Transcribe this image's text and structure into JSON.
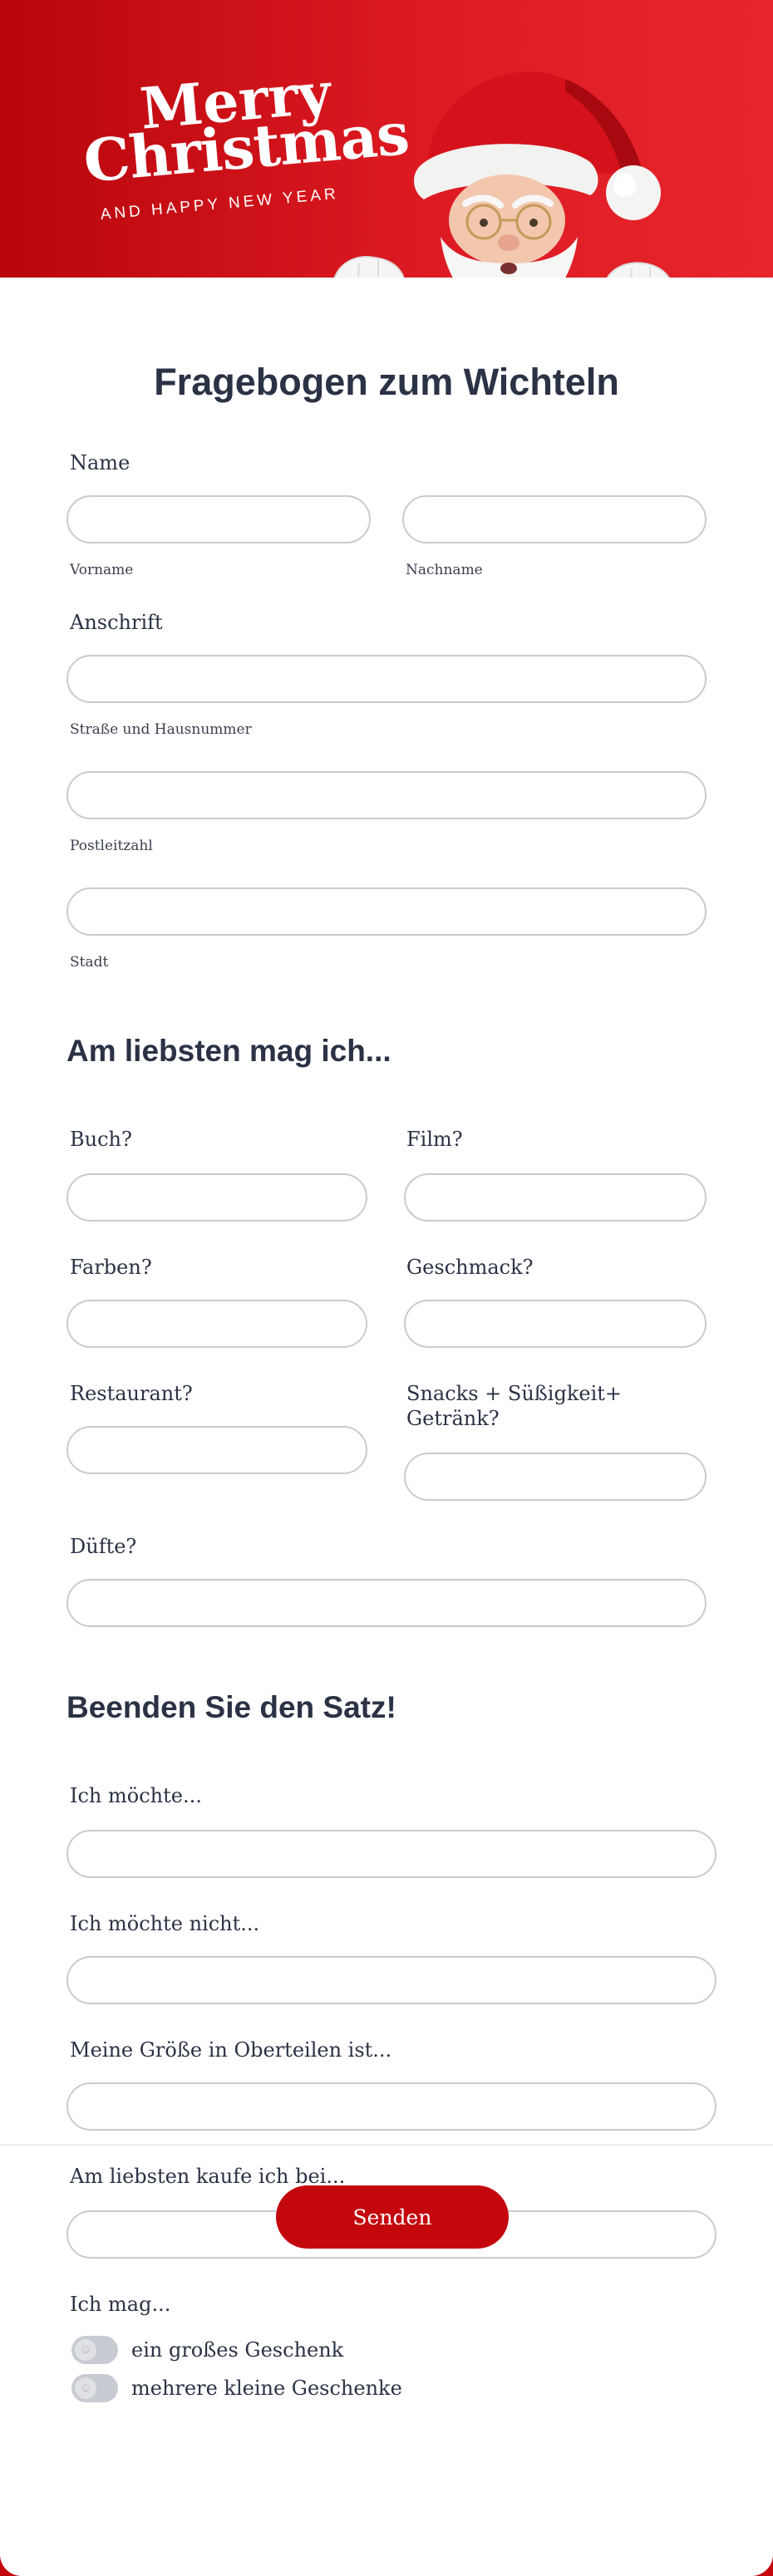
{
  "header": {
    "logo_line1": "Merry",
    "logo_line2": "Christmas",
    "logo_line3": "AND HAPPY NEW YEAR",
    "colors": {
      "background": "#d6141c",
      "text": "#ffffff"
    }
  },
  "form": {
    "title": "Fragebogen zum Wichteln",
    "name": {
      "label": "Name",
      "first_sublabel": "Vorname",
      "last_sublabel": "Nachname",
      "first_value": "",
      "last_value": ""
    },
    "address": {
      "label": "Anschrift",
      "street_sublabel": "Straße und Hausnummer",
      "zip_sublabel": "Postleitzahl",
      "city_sublabel": "Stadt"
    },
    "favorites": {
      "title": "Am liebsten mag ich...",
      "book": "Buch?",
      "film": "Film?",
      "colors": "Farben?",
      "taste": "Geschmack?",
      "restaurant": "Restaurant?",
      "snacks": "Snacks + Süßigkeit+ Getränk?",
      "scents": "Düfte?"
    },
    "sentences": {
      "title": "Beenden Sie den Satz!",
      "want": "Ich möchte...",
      "dont_want": "Ich möchte nicht...",
      "size": "Meine Größe in Oberteilen ist...",
      "shop": "Am liebsten kaufe ich bei...",
      "like": "Ich mag...",
      "option1": "ein großes Geschenk",
      "option2": "mehrere kleine Geschenke"
    },
    "submit_label": "Senden",
    "accent_color": "#c4060d"
  }
}
